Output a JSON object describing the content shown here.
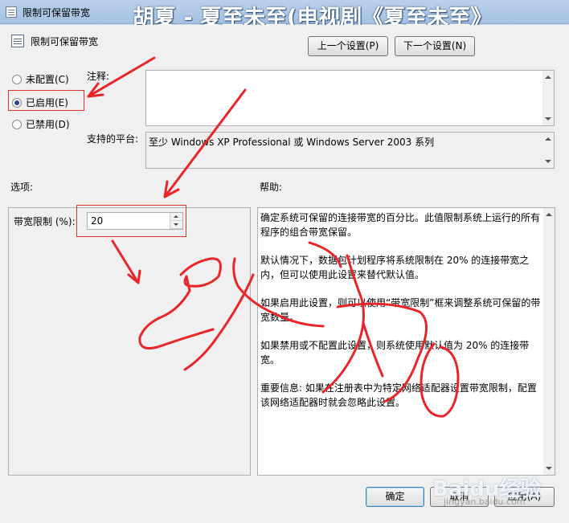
{
  "window": {
    "title": "限制可保留带宽",
    "overlay_title": "胡夏 - 夏至未至(电视剧《夏至未至》"
  },
  "header": {
    "setting_name": "限制可保留带宽",
    "prev_button": "上一个设置(P)",
    "next_button": "下一个设置(N)"
  },
  "state": {
    "options": [
      "未配置(C)",
      "已启用(E)",
      "已禁用(D)"
    ],
    "selected_index": 1
  },
  "comment": {
    "label": "注释:",
    "value": ""
  },
  "platform": {
    "label": "支持的平台:",
    "value": "至少 Windows XP Professional 或 Windows Server 2003 系列"
  },
  "options_section": {
    "label": "选项:",
    "bandwidth_label": "带宽限制 (%):",
    "bandwidth_value": "20"
  },
  "help_section": {
    "label": "帮助:",
    "paragraphs": [
      "确定系统可保留的连接带宽的百分比。此值限制系统上运行的所有程序的组合带宽保留。",
      "默认情况下，数据包计划程序将系统限制在 20% 的连接带宽之内，但可以使用此设置来替代默认值。",
      "如果启用此设置，则可以使用“带宽限制”框来调整系统可保留的带宽数量。",
      "如果禁用或不配置此设置，则系统使用默认值为 20% 的连接带宽。",
      "重要信息: 如果在注册表中为特定网络适配器设置带宽限制，配置该网络适配器时就会忽略此设置。"
    ]
  },
  "footer": {
    "ok": "确定",
    "cancel": "取消",
    "apply": "应用(A)"
  },
  "annotation": {
    "handwriting": "改为0",
    "color": "#e8262a"
  },
  "brand": {
    "name": "Baidu经验",
    "url": "jingyan.baidu.com"
  }
}
